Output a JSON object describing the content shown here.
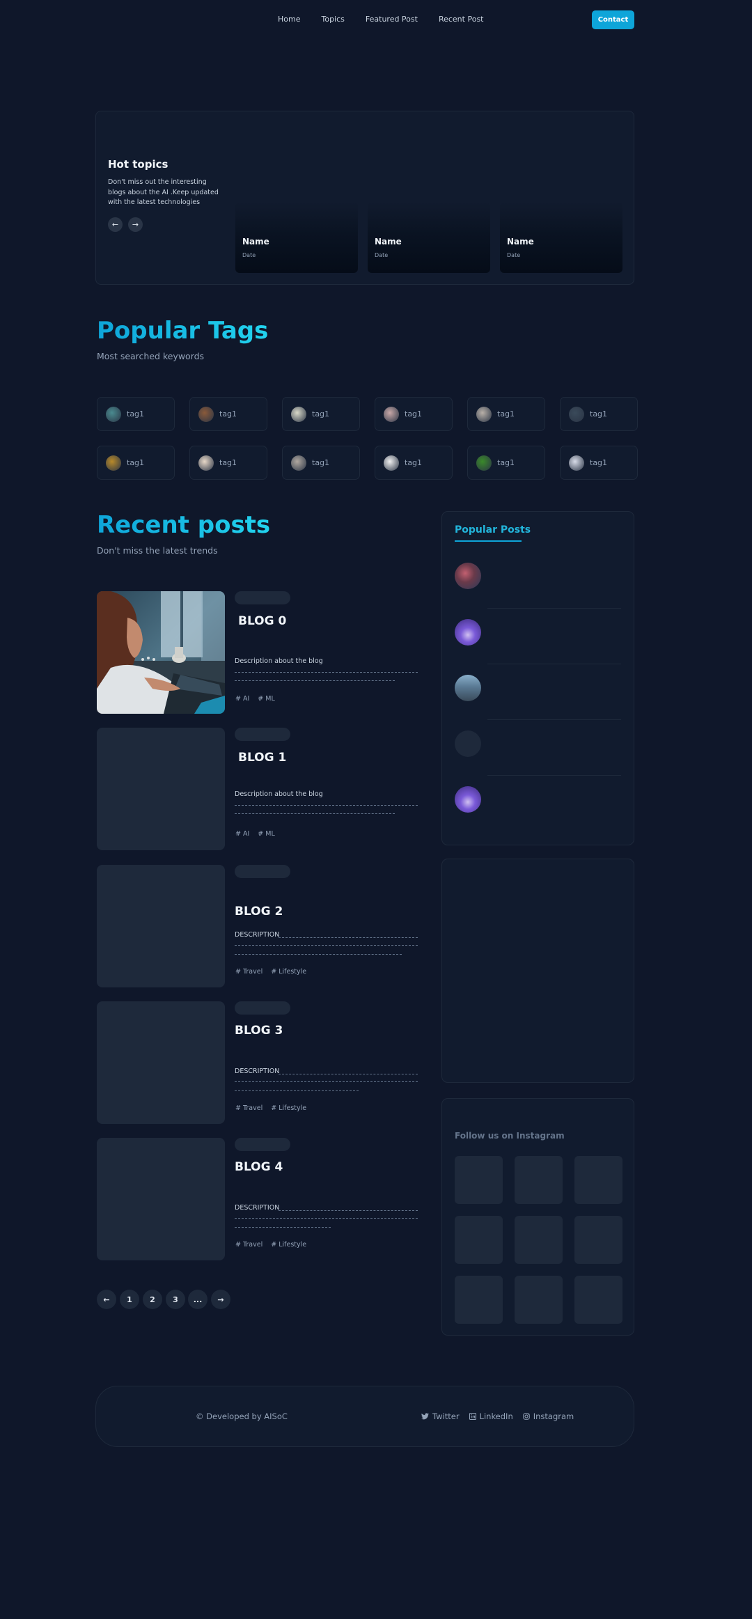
{
  "nav": {
    "links": [
      "Home",
      "Topics",
      "Featured Post",
      "Recent Post"
    ],
    "contact_label": "Contact"
  },
  "hot_topics": {
    "title": "Hot topics",
    "description": "Don't  miss out the interesting blogs about the AI .Keep updated with the latest technologies",
    "prev_icon": "arrow-left-icon",
    "next_icon": "arrow-right-icon",
    "cards": [
      {
        "name": "Name",
        "date": "Date"
      },
      {
        "name": "Name",
        "date": "Date"
      },
      {
        "name": "Name",
        "date": "Date"
      }
    ]
  },
  "popular_tags": {
    "title": "Popular Tags",
    "subtitle": "Most searched keywords",
    "tags": [
      {
        "label": "tag1",
        "color": "#4a8a8f"
      },
      {
        "label": "tag1",
        "color": "#8a5a3a"
      },
      {
        "label": "tag1",
        "color": "#d8d8c8"
      },
      {
        "label": "tag1",
        "color": "#c8a8a8"
      },
      {
        "label": "tag1",
        "color": "#b8b0a8"
      },
      {
        "label": "tag1",
        "color": "#3a4a5a"
      },
      {
        "label": "tag1",
        "color": "#b88a2a"
      },
      {
        "label": "tag1",
        "color": "#e8d8c8"
      },
      {
        "label": "tag1",
        "color": "#b0a8a0"
      },
      {
        "label": "tag1",
        "color": "#f0f0f0"
      },
      {
        "label": "tag1",
        "color": "#3a8a2a"
      },
      {
        "label": "tag1",
        "color": "#d8dce8"
      }
    ]
  },
  "recent_posts": {
    "title": "Recent posts",
    "subtitle": "Don't miss the latest trends",
    "posts": [
      {
        "title": "BLOG 0",
        "description": "Description about the blog",
        "tags": [
          "# AI",
          "# ML"
        ]
      },
      {
        "title": "BLOG 1",
        "description": "Description about the blog",
        "tags": [
          "# AI",
          "# ML"
        ]
      },
      {
        "title": "BLOG 2",
        "description": "DESCRIPTION",
        "tags": [
          "# Travel",
          "# Lifestyle"
        ]
      },
      {
        "title": "BLOG 3",
        "description": "DESCRIPTION",
        "tags": [
          "# Travel",
          "# Lifestyle"
        ]
      },
      {
        "title": "BLOG 4",
        "description": "DESCRIPTION",
        "tags": [
          "# Travel",
          "# Lifestyle"
        ]
      }
    ],
    "pagination": [
      "1",
      "2",
      "3",
      "..."
    ]
  },
  "sidebar": {
    "popular_posts_title": "Popular Posts",
    "popular_post_avatars": [
      "#6a4a5a",
      "#5a4ab8",
      "#6a8aa8",
      "#1e293b",
      "#5a4ab8"
    ],
    "instagram_title": "Follow us on Instagram"
  },
  "footer": {
    "credit": "© Developed  by AISoC",
    "links": [
      {
        "label": "Twitter",
        "icon": "twitter-icon"
      },
      {
        "label": "LinkedIn",
        "icon": "linkedin-icon"
      },
      {
        "label": "Instagram",
        "icon": "instagram-icon"
      }
    ]
  },
  "colors": {
    "background": "#0f172a",
    "accent": "#0ea5d9",
    "panel": "#111b2e"
  }
}
